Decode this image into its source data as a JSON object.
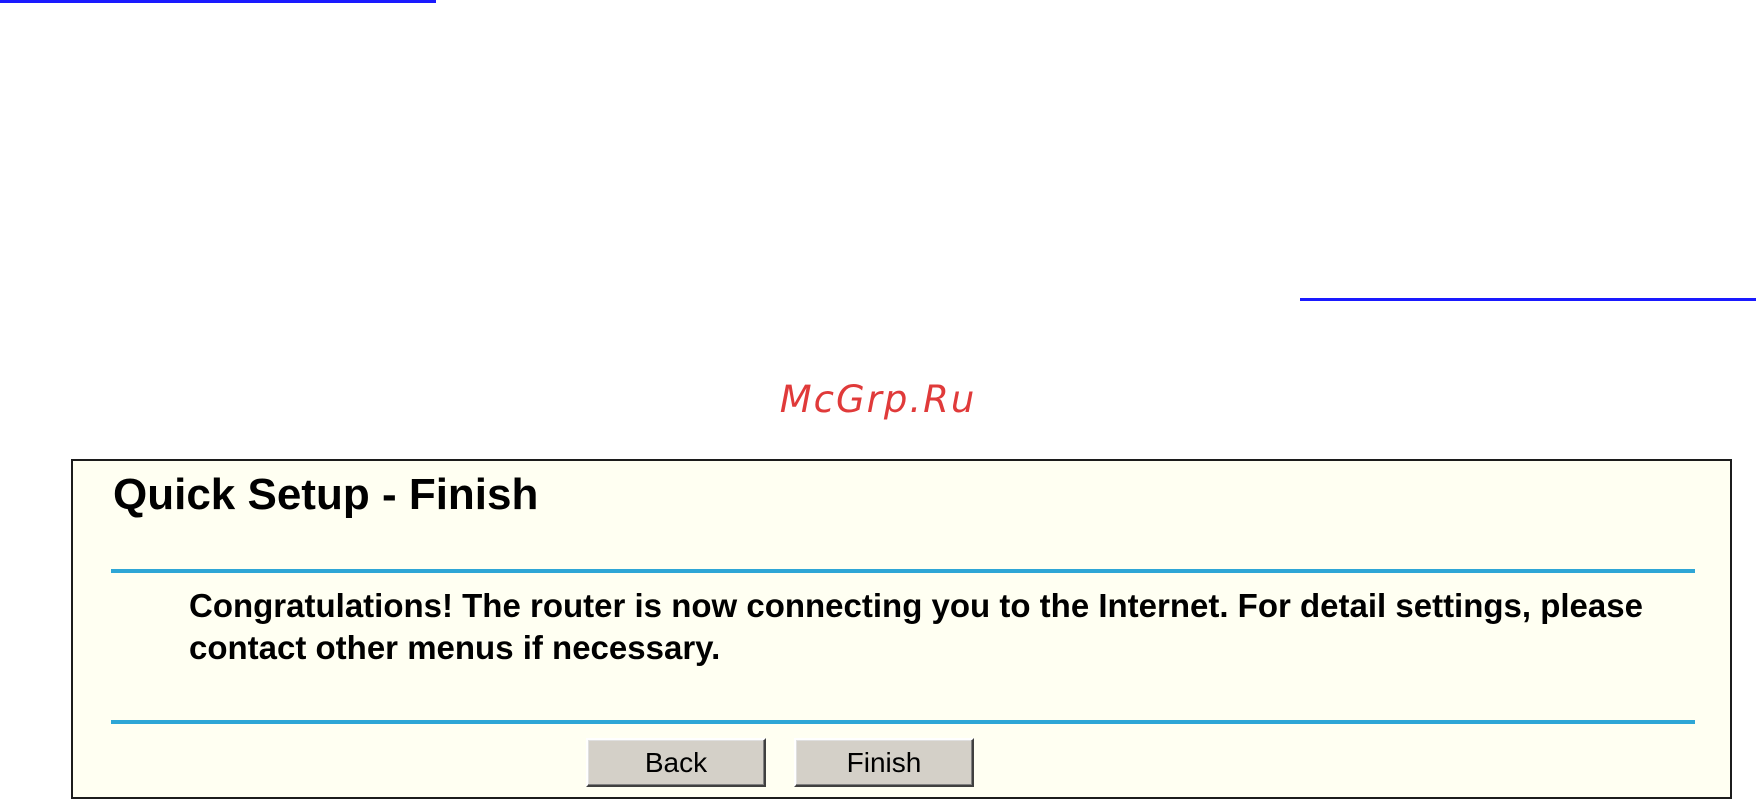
{
  "watermark": "McGrp.Ru",
  "panel": {
    "title": "Quick Setup - Finish",
    "message": "Congratulations! The router is now connecting you to the Internet. For detail settings, please contact other menus if necessary."
  },
  "buttons": {
    "back_label": "Back",
    "finish_label": "Finish"
  },
  "colors": {
    "panel_background": "#fffff2",
    "rule": "#2ea6d6",
    "button_face": "#d4d0c8",
    "watermark": "#e03a3a",
    "decorative_line": "#1a1aff"
  }
}
